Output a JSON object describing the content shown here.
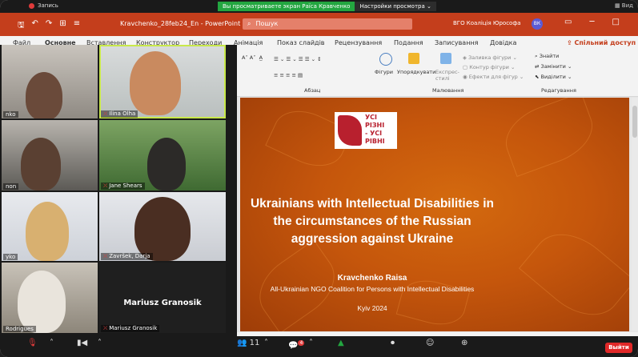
{
  "zoom": {
    "recording_label": "Запись",
    "share_notice": "Вы просматриваете экран Раїса Кравченко",
    "view_options": "Настройки просмотра",
    "view_label": "Вид"
  },
  "powerpoint": {
    "doc_title": "Kravchenko_28feb24_En - PowerPoint",
    "search_placeholder": "Пошук",
    "org_name": "ВГО Коаліція Юрософа",
    "avatar_initials": "ВК",
    "accent_color": "#c43e1c",
    "tabs": [
      "Файл",
      "Основне",
      "Вставлення",
      "Конструктор",
      "Переходи",
      "Анімація",
      "Показ слайдів",
      "Рецензування",
      "Подання",
      "Записування",
      "Довідка"
    ],
    "shared_access": "Спільний доступ",
    "ribbon": {
      "shapes": "Фігури",
      "arrange": "Упорядкувати",
      "quick_styles": "Експрес-стилі",
      "shape_fill": "Заливка фігури",
      "shape_outline": "Контур фігури",
      "shape_effects": "Ефекти для фігур",
      "find": "Знайти",
      "replace": "Замінити",
      "select": "Виділити",
      "group_paragraph": "Абзац",
      "group_drawing": "Малювання",
      "group_editing": "Редагування"
    }
  },
  "slide": {
    "logo_text": [
      "УСІ",
      "РІЗНІ",
      "- УСІ",
      "РІВНІ"
    ],
    "title": "Ukrainians with Intellectual Disabilities in the circumstances of the Russian aggression against Ukraine",
    "author": "Kravchenko Raisa",
    "organization": "All-Ukrainian NGO Coalition for Persons with Intellectual Disabilities",
    "place_year": "Kyiv 2024"
  },
  "participants": [
    {
      "name": "nko",
      "muted": false
    },
    {
      "name": "Ilina Olha",
      "muted": true
    },
    {
      "name": "non",
      "muted": false
    },
    {
      "name": "Jane Shears",
      "muted": true
    },
    {
      "name": "yko",
      "muted": false
    },
    {
      "name": "Završek, Darja",
      "muted": true
    },
    {
      "name": "Rodrigues",
      "muted": false
    },
    {
      "name": "Mariusz Granosik",
      "muted": true
    }
  ],
  "center_name": "Mariusz Granosik",
  "toolbar": {
    "participants_count": "11",
    "chat_badge": "4",
    "leave": "Выйти"
  }
}
